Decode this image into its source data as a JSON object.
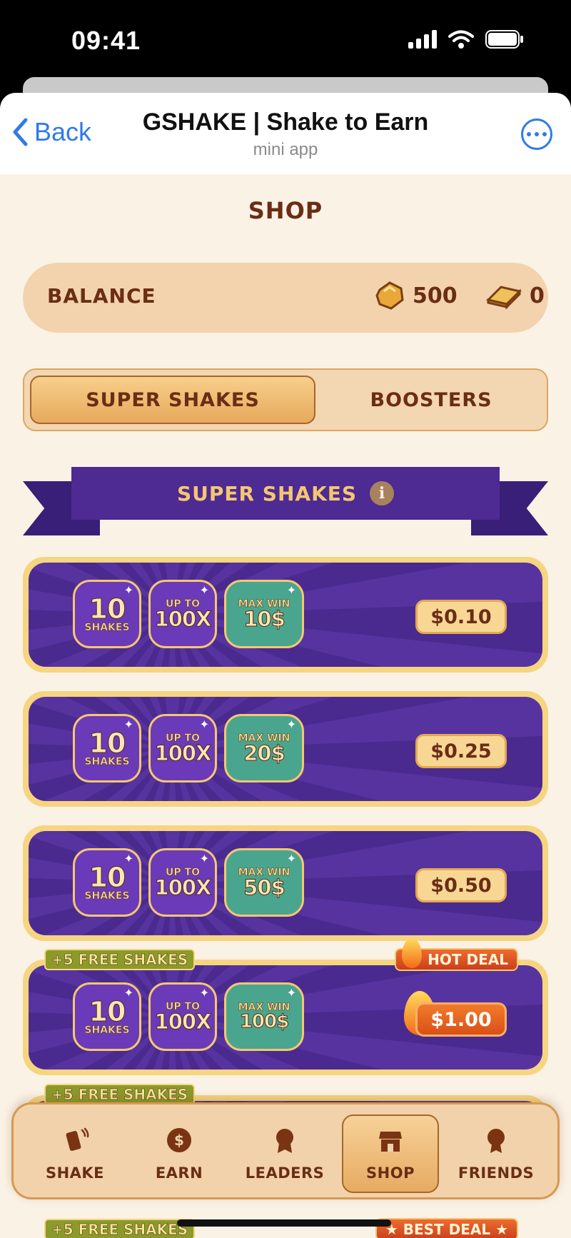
{
  "status_bar": {
    "time": "09:41"
  },
  "telegram": {
    "back_label": "Back",
    "title": "GSHAKE | Shake to Earn",
    "subtitle": "mini app"
  },
  "page": {
    "title": "SHOP"
  },
  "balance": {
    "label": "BALANCE",
    "gold": "500",
    "bars": "0"
  },
  "tabs": [
    {
      "label": "SUPER SHAKES",
      "active": true
    },
    {
      "label": "BOOSTERS",
      "active": false
    }
  ],
  "section": {
    "title": "SUPER SHAKES",
    "info": "i"
  },
  "offers": [
    {
      "shakes": "10",
      "shakes_label": "SHAKES",
      "up_label": "UP TO",
      "multiplier": "100X",
      "max_label": "MAX WIN",
      "max_win": "10$",
      "price": "$0.10"
    },
    {
      "shakes": "10",
      "shakes_label": "SHAKES",
      "up_label": "UP TO",
      "multiplier": "100X",
      "max_label": "MAX WIN",
      "max_win": "20$",
      "price": "$0.25"
    },
    {
      "shakes": "10",
      "shakes_label": "SHAKES",
      "up_label": "UP TO",
      "multiplier": "100X",
      "max_label": "MAX WIN",
      "max_win": "50$",
      "price": "$0.50"
    },
    {
      "shakes": "10",
      "shakes_label": "SHAKES",
      "up_label": "UP TO",
      "multiplier": "100X",
      "max_label": "MAX WIN",
      "max_win": "100$",
      "price": "$1.00",
      "bonus": "+5 FREE SHAKES",
      "deal": "HOT DEAL"
    }
  ],
  "peek_tags": {
    "free_1": "+5 FREE SHAKES",
    "free_2": "+5 FREE SHAKES",
    "best_deal": "★ BEST DEAL ★"
  },
  "nav": [
    {
      "label": "SHAKE",
      "icon": "phone-shake-icon"
    },
    {
      "label": "EARN",
      "icon": "dollar-coin-icon"
    },
    {
      "label": "LEADERS",
      "icon": "medal-icon"
    },
    {
      "label": "SHOP",
      "icon": "store-icon",
      "active": true
    },
    {
      "label": "FRIENDS",
      "icon": "ribbon-badge-icon"
    }
  ],
  "colors": {
    "accent_purple": "#4e2a93",
    "gold": "#f4c771",
    "brown_text": "#6b2d14",
    "background": "#fbf2e6"
  }
}
